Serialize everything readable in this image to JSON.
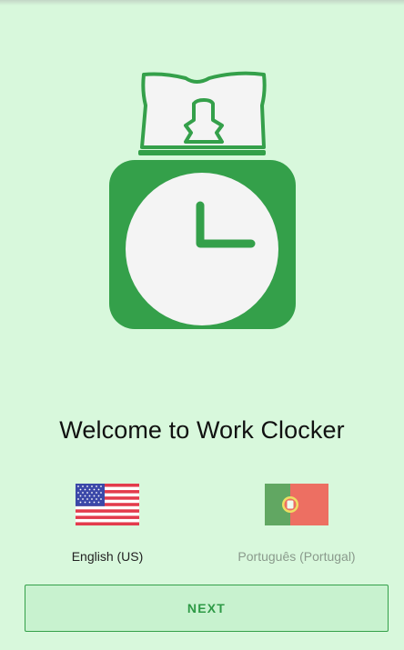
{
  "app": {
    "welcome_title": "Welcome to Work Clocker",
    "logo_icon": "time-clock-icon"
  },
  "languages": [
    {
      "label": "English (US)",
      "flag_icon": "us-flag-icon",
      "selected": true
    },
    {
      "label": "Português (Portugal)",
      "flag_icon": "portugal-flag-icon",
      "selected": false
    }
  ],
  "actions": {
    "next_label": "NEXT"
  },
  "colors": {
    "background": "#d8f8dc",
    "accent": "#34a04a",
    "button_fill": "#c8f2cf"
  }
}
